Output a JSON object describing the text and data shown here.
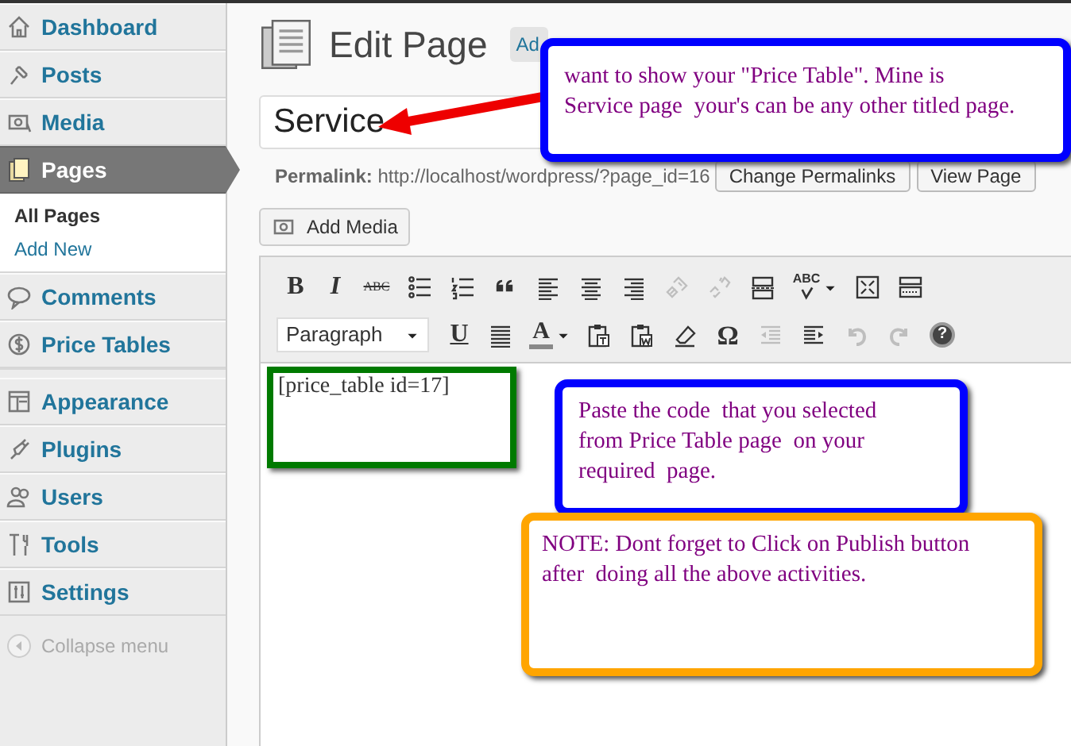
{
  "sidebar": {
    "items": [
      {
        "label": "Dashboard",
        "selected": false
      },
      {
        "label": "Posts",
        "selected": false
      },
      {
        "label": "Media",
        "selected": false
      },
      {
        "label": "Pages",
        "selected": true,
        "children": [
          {
            "label": "All Pages",
            "selected": true
          },
          {
            "label": "Add New",
            "selected": false
          }
        ]
      },
      {
        "label": "Comments",
        "selected": false
      },
      {
        "label": "Price Tables",
        "selected": false
      },
      {
        "label": "Appearance",
        "selected": false
      },
      {
        "label": "Plugins",
        "selected": false
      },
      {
        "label": "Users",
        "selected": false
      },
      {
        "label": "Tools",
        "selected": false
      },
      {
        "label": "Settings",
        "selected": false
      }
    ],
    "collapse": "Collapse menu"
  },
  "header": {
    "title": "Edit Page",
    "add_new_button": "Ad"
  },
  "title_field": {
    "value": "Service"
  },
  "permalink": {
    "label": "Permalink:",
    "url": "http://localhost/wordpress/?page_id=16",
    "buttons": [
      "Change Permalinks",
      "View Page"
    ]
  },
  "add_media_button": "Add Media",
  "toolbar": {
    "top_row": [
      {
        "kind": "bold",
        "label": "B",
        "disabled": false
      },
      {
        "kind": "italic",
        "label": "I",
        "disabled": false
      },
      {
        "kind": "strike",
        "label": "ABC",
        "disabled": false
      },
      {
        "kind": "bullets",
        "disabled": false
      },
      {
        "kind": "numbers",
        "disabled": false
      },
      {
        "kind": "quote",
        "disabled": false
      },
      {
        "kind": "align-left",
        "disabled": false
      },
      {
        "kind": "align-center",
        "disabled": false
      },
      {
        "kind": "align-right",
        "disabled": false
      },
      {
        "kind": "link",
        "disabled": true
      },
      {
        "kind": "unlink",
        "disabled": true
      },
      {
        "kind": "more",
        "disabled": false
      },
      {
        "kind": "spellcheck",
        "label": "ABC",
        "disabled": false
      },
      {
        "kind": "fullscreen",
        "disabled": false
      },
      {
        "kind": "kitchen-sink",
        "disabled": false
      }
    ],
    "bottom_row": [
      {
        "kind": "format",
        "label": "Paragraph",
        "disabled": false
      },
      {
        "kind": "underline",
        "label": "U",
        "disabled": false
      },
      {
        "kind": "justify",
        "disabled": false
      },
      {
        "kind": "text-color",
        "label": "A",
        "disabled": false
      },
      {
        "kind": "paste-text",
        "disabled": false
      },
      {
        "kind": "paste-word",
        "disabled": false
      },
      {
        "kind": "eraser",
        "disabled": false
      },
      {
        "kind": "char",
        "label": "Ω",
        "disabled": false
      },
      {
        "kind": "outdent",
        "disabled": true
      },
      {
        "kind": "indent",
        "disabled": false
      },
      {
        "kind": "undo",
        "disabled": true
      },
      {
        "kind": "redo",
        "disabled": true
      },
      {
        "kind": "help",
        "label": "?",
        "disabled": false
      }
    ]
  },
  "editor": {
    "content": "[price_table id=17]"
  },
  "callouts": [
    {
      "kind": "blue",
      "text": "want to show your \"Price Table\". Mine is Service page  your's can be any other titled page."
    },
    {
      "kind": "blue2",
      "text": "Paste the code  that you selected from Price Table page  on your required  page."
    },
    {
      "kind": "orange",
      "text": "NOTE: Dont forget to Click on Publish button after  doing all the above activities."
    }
  ]
}
